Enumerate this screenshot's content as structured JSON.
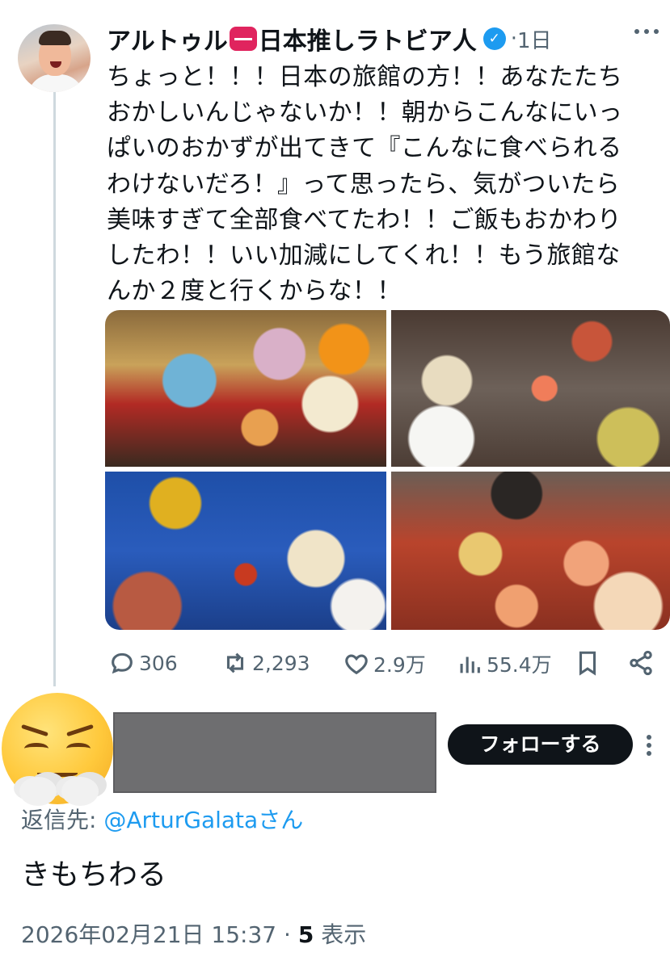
{
  "tweet": {
    "author_name": "アルトゥル",
    "author_name_suffix": "日本推しラトビア人",
    "time": "1日",
    "text_lines": [
      "ちょっと！！！日本の旅館の方！！あなたたち",
      "おかしいんじゃないか！！朝からこんなにいっ",
      "ぱいのおかずが出てきて『こんなに食べられる",
      "わけないだろ！』って思ったら、気がついたら",
      "美味すぎて全部食べてたわ！！ご飯もおかわり",
      "したわ！！いい加減にしてくれ！！もう旅館な",
      "んか２度と行くからな！！"
    ],
    "stats": {
      "replies": "306",
      "retweets": "2,293",
      "likes": "2.9万",
      "views": "55.4万"
    }
  },
  "reply": {
    "follow_label": "フォローする",
    "reply_to_prefix": "返信先: ",
    "reply_to_handle": "@ArturGalata",
    "reply_to_suffix": "さん",
    "text": "きもちわる",
    "timestamp": "2026年02月21日 15:37 · ",
    "views_count": "5",
    "views_label": " 表示"
  },
  "icons": {
    "verified": "verified-badge-icon",
    "more": "more-icon",
    "reply": "reply-icon",
    "retweet": "retweet-icon",
    "like": "heart-icon",
    "views": "views-chart-icon",
    "bookmark": "bookmark-icon",
    "share": "share-icon",
    "emoji": "steaming-angry-face-emoji"
  },
  "colors": {
    "accent": "#1d9bf0",
    "text": "#0f1419",
    "muted": "#536471",
    "follow_button": "#0f1419"
  }
}
